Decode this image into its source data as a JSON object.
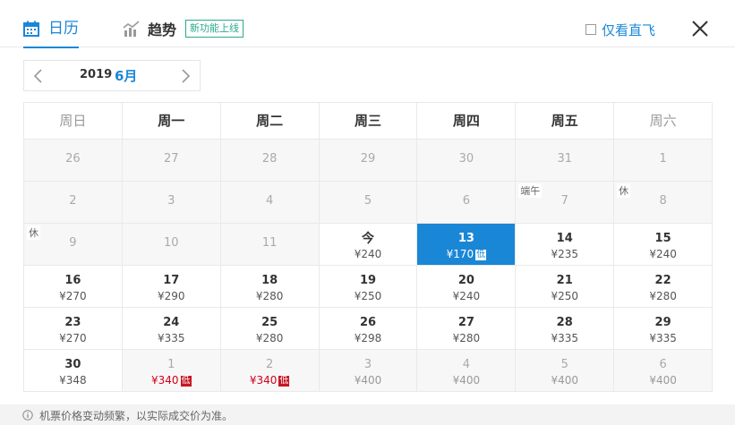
{
  "header": {
    "tab_calendar": "日历",
    "tab_trend": "趋势",
    "new_badge": "新功能上线",
    "direct_only": "仅看直飞"
  },
  "month_nav": {
    "year": "2019",
    "month": "6月"
  },
  "weekdays": [
    "周日",
    "周一",
    "周二",
    "周三",
    "周四",
    "周五",
    "周六"
  ],
  "weeks": [
    [
      {
        "day": "26",
        "price": "",
        "state": "gray"
      },
      {
        "day": "27",
        "price": "",
        "state": "gray"
      },
      {
        "day": "28",
        "price": "",
        "state": "gray"
      },
      {
        "day": "29",
        "price": "",
        "state": "gray"
      },
      {
        "day": "30",
        "price": "",
        "state": "gray"
      },
      {
        "day": "31",
        "price": "",
        "state": "gray"
      },
      {
        "day": "1",
        "price": "",
        "state": "past"
      }
    ],
    [
      {
        "day": "2",
        "price": "",
        "state": "past"
      },
      {
        "day": "3",
        "price": "",
        "state": "past"
      },
      {
        "day": "4",
        "price": "",
        "state": "past"
      },
      {
        "day": "5",
        "price": "",
        "state": "past"
      },
      {
        "day": "6",
        "price": "",
        "state": "past"
      },
      {
        "day": "7",
        "price": "",
        "state": "past",
        "holiday": "端午"
      },
      {
        "day": "8",
        "price": "",
        "state": "past",
        "holiday": "休"
      }
    ],
    [
      {
        "day": "9",
        "price": "",
        "state": "past",
        "holiday": "休"
      },
      {
        "day": "10",
        "price": "",
        "state": "past"
      },
      {
        "day": "11",
        "price": "",
        "state": "past"
      },
      {
        "day": "今",
        "price": "¥240",
        "state": "today"
      },
      {
        "day": "13",
        "price": "¥170",
        "state": "selected",
        "low": "低"
      },
      {
        "day": "14",
        "price": "¥235",
        "state": "normal"
      },
      {
        "day": "15",
        "price": "¥240",
        "state": "normal"
      }
    ],
    [
      {
        "day": "16",
        "price": "¥270",
        "state": "normal"
      },
      {
        "day": "17",
        "price": "¥290",
        "state": "normal"
      },
      {
        "day": "18",
        "price": "¥280",
        "state": "normal"
      },
      {
        "day": "19",
        "price": "¥250",
        "state": "normal"
      },
      {
        "day": "20",
        "price": "¥240",
        "state": "normal"
      },
      {
        "day": "21",
        "price": "¥250",
        "state": "normal"
      },
      {
        "day": "22",
        "price": "¥280",
        "state": "normal"
      }
    ],
    [
      {
        "day": "23",
        "price": "¥270",
        "state": "normal"
      },
      {
        "day": "24",
        "price": "¥335",
        "state": "normal"
      },
      {
        "day": "25",
        "price": "¥280",
        "state": "normal"
      },
      {
        "day": "26",
        "price": "¥298",
        "state": "normal"
      },
      {
        "day": "27",
        "price": "¥280",
        "state": "normal"
      },
      {
        "day": "28",
        "price": "¥335",
        "state": "normal"
      },
      {
        "day": "29",
        "price": "¥335",
        "state": "normal"
      }
    ],
    [
      {
        "day": "30",
        "price": "¥348",
        "state": "normal"
      },
      {
        "day": "1",
        "price": "¥340",
        "state": "next-low",
        "low": "低"
      },
      {
        "day": "2",
        "price": "¥340",
        "state": "next-low",
        "low": "低"
      },
      {
        "day": "3",
        "price": "¥400",
        "state": "next"
      },
      {
        "day": "4",
        "price": "¥400",
        "state": "next"
      },
      {
        "day": "5",
        "price": "¥400",
        "state": "next"
      },
      {
        "day": "6",
        "price": "¥400",
        "state": "next"
      }
    ]
  ],
  "footer": {
    "note": "机票价格变动频繁，以实际成交价为准。"
  },
  "colors": {
    "accent": "#1a87d6",
    "low_red": "#c81623",
    "badge_green": "#2aaa8a"
  }
}
